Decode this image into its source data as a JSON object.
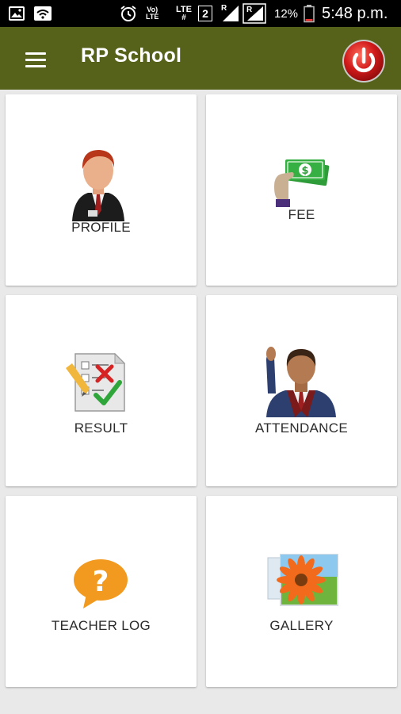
{
  "status_bar": {
    "volte": "Vo)",
    "volte_lte": "LTE",
    "lte": "LTE",
    "lte_sub": "#",
    "sim": "2",
    "roaming1": "R",
    "roaming2": "R",
    "battery": "12%",
    "time": "5:48 p.m."
  },
  "app_bar": {
    "title": "RP School"
  },
  "tiles": [
    {
      "label": "PROFILE",
      "icon": "profile-icon"
    },
    {
      "label": "FEE",
      "icon": "fee-icon"
    },
    {
      "label": "RESULT",
      "icon": "result-icon"
    },
    {
      "label": "ATTENDANCE",
      "icon": "attendance-icon"
    },
    {
      "label": "TEACHER LOG",
      "icon": "teacher-log-icon",
      "icon_glyph": "?"
    },
    {
      "label": "GALLERY",
      "icon": "gallery-icon"
    }
  ],
  "colors": {
    "app_bar": "#566219",
    "power_button": "#d01a1a",
    "background": "#e9e9e9"
  }
}
